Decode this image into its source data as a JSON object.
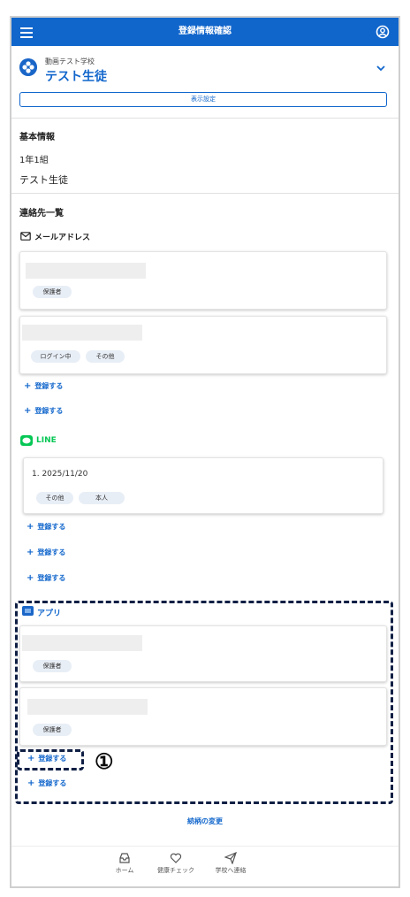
{
  "header": {
    "title": "登録情報確認"
  },
  "school": {
    "name": "動画テスト学校",
    "student": "テスト生徒",
    "display_settings": "表示設定"
  },
  "basic_info": {
    "heading": "基本情報",
    "class": "1年1組",
    "name": "テスト生徒"
  },
  "contacts": {
    "heading": "連絡先一覧",
    "email": {
      "heading": "メールアドレス",
      "cards": [
        {
          "tags": [
            "保護者"
          ]
        },
        {
          "tags": [
            "ログイン中",
            "その他"
          ]
        }
      ],
      "add_links": [
        "登録する",
        "登録する"
      ]
    },
    "line": {
      "heading": "LINE",
      "cards": [
        {
          "title": "1. 2025/11/20",
          "tags": [
            "その他",
            "本人"
          ]
        }
      ],
      "add_links": [
        "登録する",
        "登録する",
        "登録する"
      ]
    },
    "app": {
      "heading": "アプリ",
      "cards": [
        {
          "tags": [
            "保護者"
          ]
        },
        {
          "tags": [
            "保護者"
          ]
        }
      ],
      "add_links": [
        "登録する",
        "登録する"
      ]
    }
  },
  "annotation": {
    "marker": "①"
  },
  "footer_link": "続柄の変更",
  "bottom_nav": {
    "home": "ホーム",
    "health": "健康チェック",
    "contact": "学校へ連絡"
  },
  "colors": {
    "primary": "#1166cc",
    "line_green": "#06c755",
    "annotation": "#0f1f44"
  }
}
